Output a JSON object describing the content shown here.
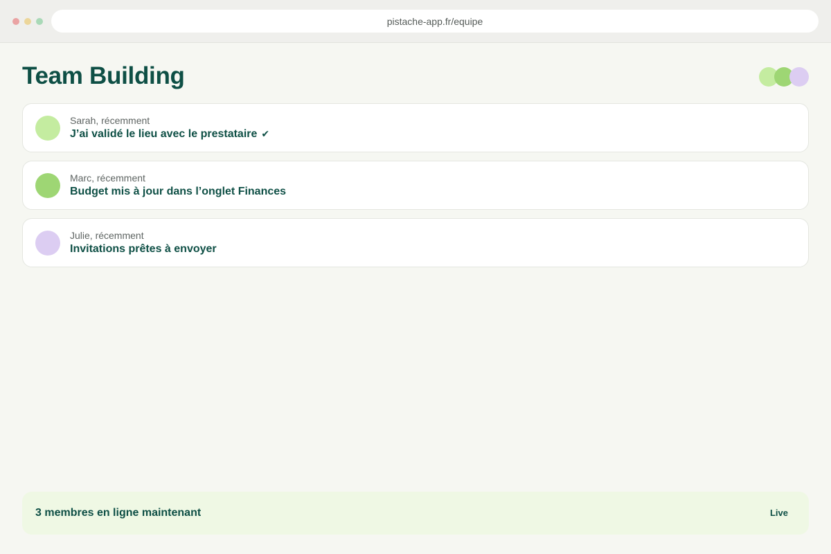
{
  "browser": {
    "url": "pistache-app.fr/equipe",
    "window_controls": [
      "close",
      "minimize",
      "maximize"
    ]
  },
  "colors": {
    "brand_dark": "#0e4f45",
    "light_green": "#c4eca0",
    "green": "#9ed674",
    "lavender": "#dccdf2",
    "status_bg": "#eff8e4",
    "dot_red": "#eaa3a3",
    "dot_yellow": "#ecd69a",
    "dot_green": "#a9d9b7"
  },
  "header": {
    "title": "Team Building",
    "online_avatars": [
      "light_green",
      "green",
      "lavender"
    ]
  },
  "feed": [
    {
      "meta": "Sarah, récemment",
      "message": "J’ai validé le lieu avec le prestataire",
      "icon": "check-icon",
      "icon_glyph": "✔",
      "avatar_color": "light_green"
    },
    {
      "meta": "Marc, récemment",
      "message": "Budget mis à jour dans l’onglet Finances",
      "avatar_color": "green"
    },
    {
      "meta": "Julie, récemment",
      "message": "Invitations prêtes à envoyer",
      "avatar_color": "lavender"
    }
  ],
  "status": {
    "text": "3 membres en ligne maintenant",
    "badge": "Live"
  }
}
